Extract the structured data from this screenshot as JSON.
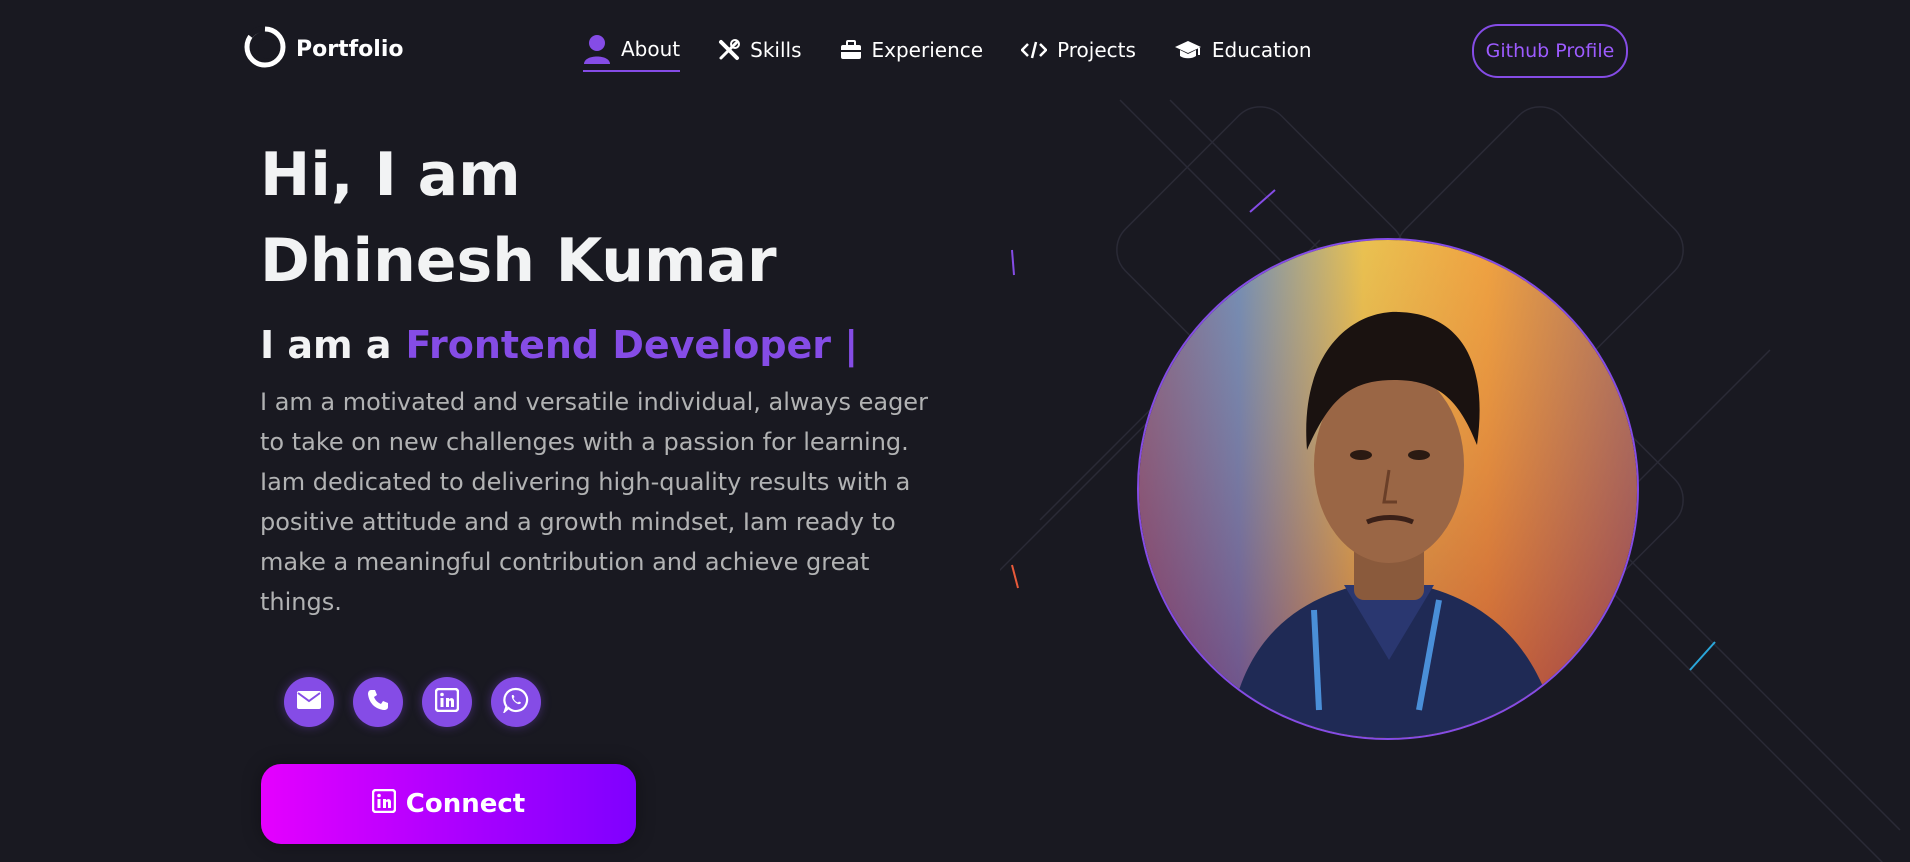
{
  "nav": {
    "logo_text": "Portfolio",
    "logo_icon": "portfolio-logo-icon",
    "links": [
      {
        "label": "About",
        "icon": "user-icon",
        "active": true
      },
      {
        "label": "Skills",
        "icon": "tools-icon"
      },
      {
        "label": "Experience",
        "icon": "briefcase-icon"
      },
      {
        "label": "Projects",
        "icon": "code-icon"
      },
      {
        "label": "Education",
        "icon": "graduation-cap-icon"
      }
    ],
    "github_button": "Github Profile"
  },
  "hero": {
    "greeting_line1": "Hi, I am",
    "greeting_line2": "Dhinesh Kumar",
    "role_prefix": "I am a",
    "role_value": "Frontend Developer |",
    "bio": "I am a motivated and versatile individual, always eager to take on new challenges with a passion for learning. Iam dedicated to delivering high-quality results with a positive attitude and a growth mindset, Iam ready to make a meaningful contribution and achieve great things.",
    "social_icons": [
      "email-icon",
      "phone-icon",
      "linkedin-icon",
      "whatsapp-icon"
    ],
    "connect_button": "Connect",
    "connect_icon": "linkedin-icon"
  },
  "colors": {
    "background": "#191921",
    "accent": "#854ce6",
    "text_primary": "#f2f3f4",
    "text_secondary": "#b1b2b3",
    "button_gradient_start": "#e500ff",
    "button_gradient_end": "#7f00ff"
  }
}
